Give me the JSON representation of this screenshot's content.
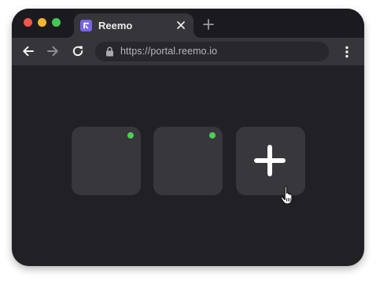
{
  "tab": {
    "title": "Reemo"
  },
  "address_bar": {
    "url": "https://portal.reemo.io"
  },
  "colors": {
    "accent_favicon": "#7a64e0",
    "online_status": "#4fcc5a",
    "window_background": "#202025",
    "tile_background": "#37373c"
  },
  "tiles": [
    {
      "kind": "machine",
      "status": "online"
    },
    {
      "kind": "machine",
      "status": "online"
    },
    {
      "kind": "add",
      "icon": "plus-icon"
    }
  ],
  "icons": [
    "close-icon",
    "plus-icon",
    "back-arrow-icon",
    "forward-arrow-icon",
    "reload-icon",
    "lock-icon",
    "kebab-menu-icon",
    "hand-cursor-icon"
  ]
}
